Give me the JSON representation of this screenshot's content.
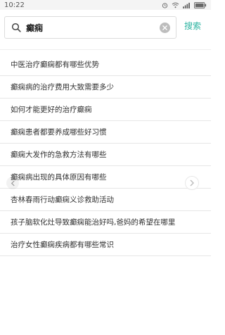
{
  "status_bar": {
    "time": "10:22"
  },
  "search": {
    "value": "癫痫",
    "button_label": "搜索"
  },
  "results": [
    "中医治疗癫痫都有哪些优势",
    "癫痫病的治疗费用大致需要多少",
    "如何才能更好的治疗癫痫",
    "癫痫患者都要养成哪些好习惯",
    "癫痫大发作的急救方法有哪些",
    "癫痫病出现的具体原因有哪些",
    "杏林春雨行动癫痫义诊救助活动",
    "孩子脑软化灶导致癫痫能治好吗,爸妈的希望在哪里",
    "治疗女性癫痫疾病都有哪些常识"
  ],
  "colors": {
    "accent": "#2bb3a0",
    "divider": "#e6e6e6",
    "text": "#333333"
  },
  "icons": {
    "status": [
      "alarm-icon",
      "wifi-icon",
      "signal-icon",
      "battery-icon"
    ],
    "search": "search-icon",
    "clear": "clear-icon",
    "nav_prev": "chevron-left-icon",
    "nav_next": "chevron-right-icon"
  }
}
